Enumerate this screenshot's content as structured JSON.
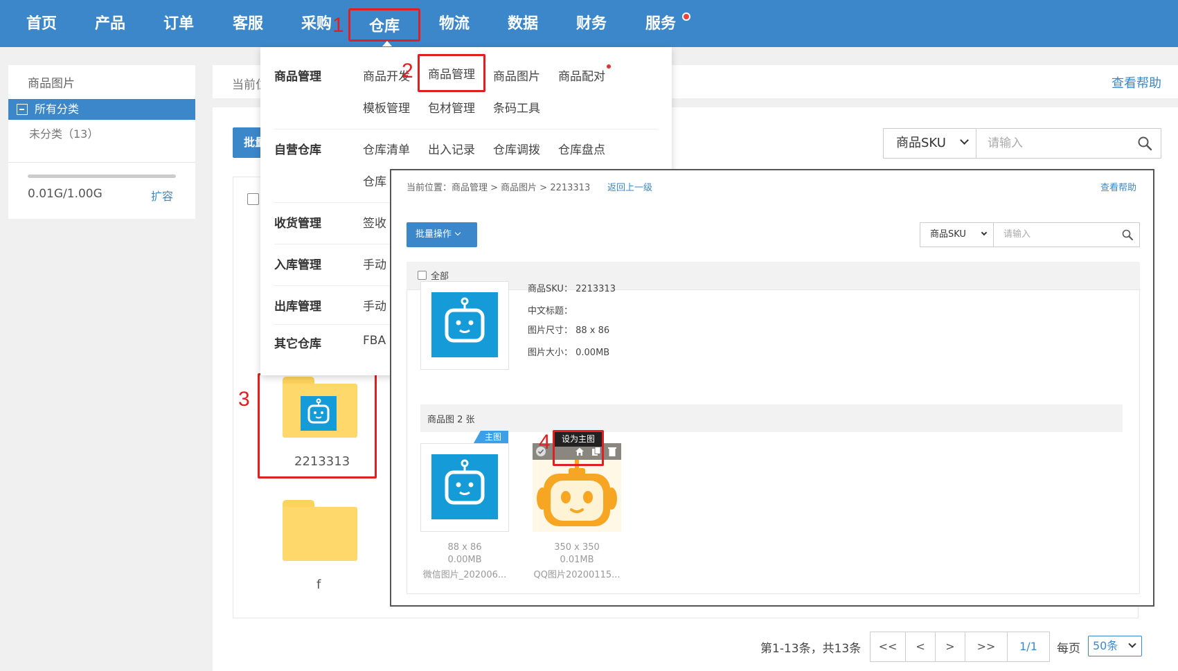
{
  "nav": {
    "items": [
      "首页",
      "产品",
      "订单",
      "客服",
      "采购",
      "仓库",
      "物流",
      "数据",
      "财务",
      "服务"
    ],
    "active_index": 5
  },
  "steps": [
    "1",
    "2",
    "3",
    "4"
  ],
  "sidebar": {
    "title": "商品图片",
    "all_label": "所有分类",
    "uncategorized": "未分类（13）",
    "storage": "0.01G/1.00G",
    "expand": "扩容"
  },
  "main": {
    "crumb": "当前位",
    "help": "查看帮助",
    "batch": "批量",
    "search_field": "商品SKU",
    "search_placeholder": "请输入",
    "folders": [
      {
        "label": "2213313"
      },
      {
        "label": "f"
      }
    ]
  },
  "dropdown": {
    "rows": [
      {
        "category": "商品管理",
        "items": [
          "商品开发",
          "商品管理",
          "商品图片",
          "商品配对"
        ]
      },
      {
        "category": "",
        "items": [
          "模板管理",
          "包材管理",
          "条码工具"
        ]
      },
      {
        "category": "自营仓库",
        "items": [
          "仓库清单",
          "出入记录",
          "仓库调拨",
          "仓库盘点"
        ]
      },
      {
        "category": "",
        "items": [
          "仓库"
        ]
      },
      {
        "category": "收货管理",
        "items": [
          "签收"
        ]
      },
      {
        "category": "入库管理",
        "items": [
          "手动"
        ]
      },
      {
        "category": "出库管理",
        "items": [
          "手动"
        ]
      },
      {
        "category": "其它仓库",
        "items": [
          "FBA"
        ]
      }
    ]
  },
  "overlay": {
    "crumb": "当前位置：商品管理 > 商品图片 > 2213313",
    "back": "返回上一级",
    "help": "查看帮助",
    "batch": "批量操作",
    "search_field": "商品SKU",
    "search_placeholder": "请输入",
    "all": "全部",
    "info": {
      "sku": "商品SKU：  2213313",
      "cn_title": "中文标题：",
      "size": "图片尺寸：  88 x 86",
      "filesize": "图片大小：  0.00MB"
    },
    "images_header": "商品图 2 张",
    "main_badge": "主图",
    "tooltip": "设为主图",
    "images": [
      {
        "dims": "88 x 86",
        "size": "0.00MB",
        "name": "微信图片_202006..."
      },
      {
        "dims": "350 x 350",
        "size": "0.01MB",
        "name": "QQ图片20200115..."
      }
    ]
  },
  "pagination": {
    "info": "第1-13条，共13条",
    "first": "<<",
    "prev": "<",
    "next": ">",
    "last": ">>",
    "current": "1/1",
    "per_label": "每页",
    "per_value": "50条"
  },
  "colors": {
    "nav_blue": "#3c87ca",
    "highlight_red": "#e02020",
    "thumb_blue": "#159bd8",
    "folder_yellow": "#fed86b",
    "robot_orange": "#f6a623"
  }
}
